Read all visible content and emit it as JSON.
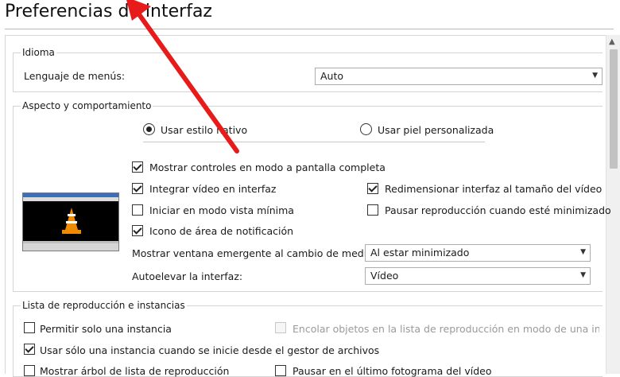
{
  "page": {
    "title": "Preferencias de interfaz"
  },
  "idioma": {
    "group_label": "Idioma",
    "menu_language_label": "Lenguaje de menús:",
    "menu_language_value": "Auto"
  },
  "aspecto": {
    "group_label": "Aspecto y comportamiento",
    "radio_native": "Usar estilo nativo",
    "radio_custom_skin": "Usar piel personalizada",
    "selected_style": "native",
    "checkboxes": {
      "fullscreen_controls": {
        "label": "Mostrar controles en modo a pantalla completa",
        "checked": true
      },
      "embed_video": {
        "label": "Integrar vídeo en interfaz",
        "checked": true
      },
      "resize_interface": {
        "label": "Redimensionar interfaz al tamaño del vídeo",
        "checked": true
      },
      "minimal_view": {
        "label": "Iniciar en modo vista mínima",
        "checked": false
      },
      "pause_minimized": {
        "label": "Pausar reproducción cuando esté minimizado",
        "checked": false
      },
      "systray_icon": {
        "label": "Icono de área de notificación",
        "checked": true
      }
    },
    "popup_label": "Mostrar ventana emergente al cambio de medios:",
    "popup_value": "Al estar minimizado",
    "raise_label": "Autoelevar la interfaz:",
    "raise_value": "Vídeo"
  },
  "playlist": {
    "group_label": "Lista de reproducción e instancias",
    "checkboxes": {
      "one_instance": {
        "label": "Permitir solo una instancia",
        "checked": false
      },
      "enqueue_one_instance": {
        "label": "Encolar objetos en la lista de reproducción en modo de una instancia",
        "checked": false,
        "disabled": true
      },
      "one_instance_file_manager": {
        "label": "Usar sólo una instancia cuando se inicie desde el gestor de archivos",
        "checked": true
      },
      "show_playlist_tree": {
        "label": "Mostrar árbol de lista de reproducción",
        "checked": false
      },
      "pause_last_frame": {
        "label": "Pausar en el último fotograma del vídeo",
        "checked": false
      }
    }
  },
  "icons": {
    "annotation": "red-arrow-icon",
    "preview": "vlc-cone-icon",
    "dropdown": "chevron-down-icon",
    "scroll": "scroll-up-icon"
  },
  "colors": {
    "annotation_arrow": "#e81b1b",
    "vlc_orange": "#f08a00"
  }
}
